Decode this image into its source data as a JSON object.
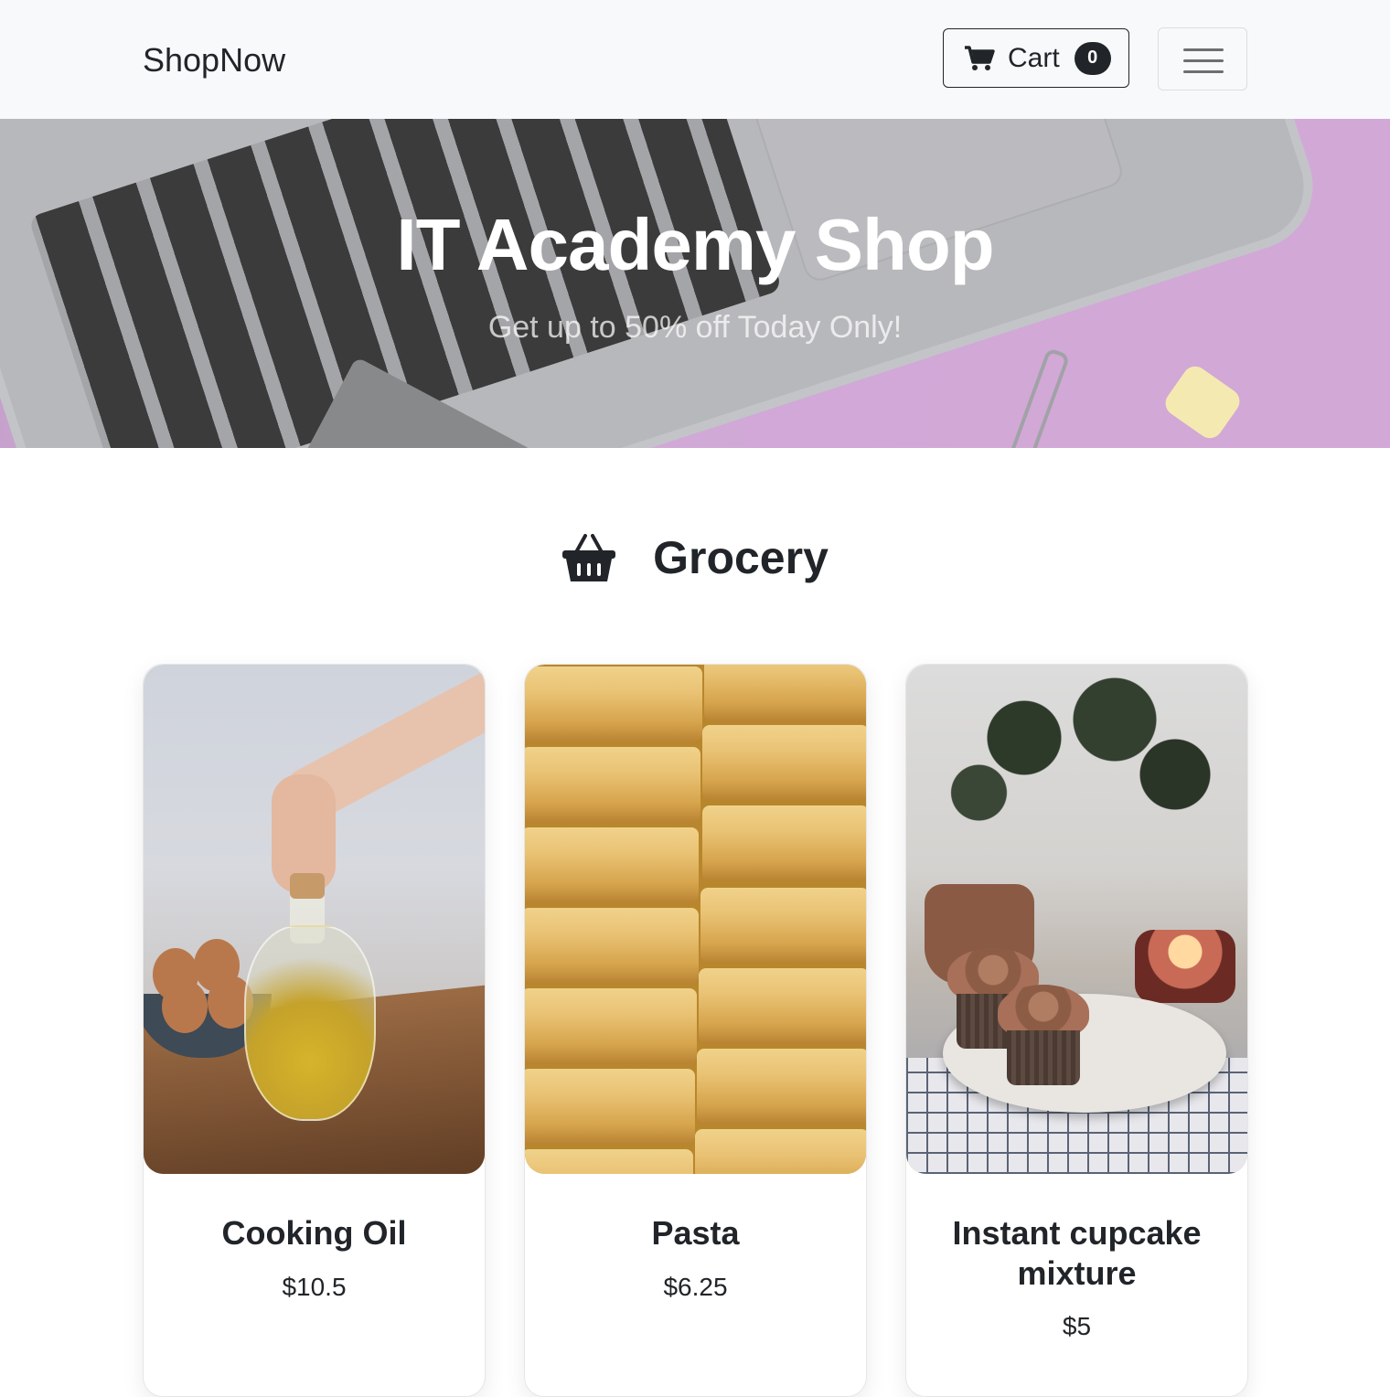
{
  "navbar": {
    "brand": "ShopNow",
    "cart_label": "Cart",
    "cart_count": "0"
  },
  "hero": {
    "title": "IT Academy Shop",
    "subtitle": "Get up to 50% off Today Only!"
  },
  "section": {
    "title": "Grocery",
    "icon": "basket-icon"
  },
  "products": [
    {
      "name": "Cooking Oil",
      "price": "$10.5"
    },
    {
      "name": "Pasta",
      "price": "$6.25"
    },
    {
      "name": "Instant cupcake mixture",
      "price": "$5"
    }
  ],
  "colors": {
    "navbar_bg": "#f8f9fa",
    "text_dark": "#212529",
    "hero_bg": "#c799cf"
  }
}
